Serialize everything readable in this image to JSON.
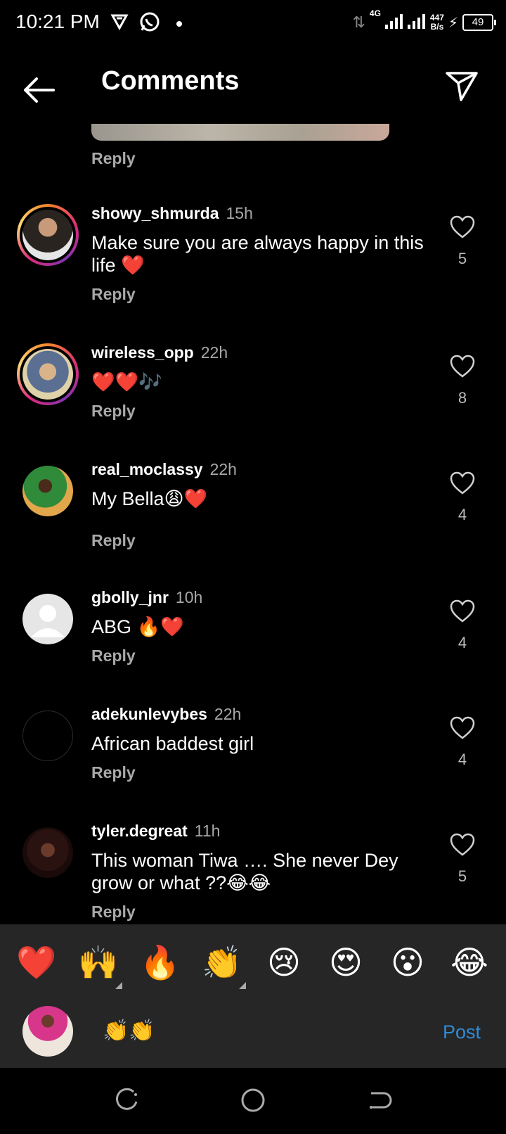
{
  "status_bar": {
    "time": "10:21 PM",
    "network": "4G",
    "speed_value": "447",
    "speed_unit": "B/s",
    "battery": "49"
  },
  "header": {
    "title": "Comments"
  },
  "top_reply": "Reply",
  "comments": [
    {
      "username": "showy_shmurda",
      "time": "15h",
      "text": "Make sure you are always happy in this life ❤️",
      "reply": "Reply",
      "likes": "5"
    },
    {
      "username": "wireless_opp",
      "time": "22h",
      "text": "❤️❤️🎶",
      "reply": "Reply",
      "likes": "8"
    },
    {
      "username": "real_moclassy",
      "time": "22h",
      "text": "My Bella😩❤️",
      "reply": "Reply",
      "likes": "4"
    },
    {
      "username": "gbolly_jnr",
      "time": "10h",
      "text": "ABG 🔥❤️",
      "reply": "Reply",
      "likes": "4"
    },
    {
      "username": "adekunlevybes",
      "time": "22h",
      "text": "African baddest girl",
      "reply": "Reply",
      "likes": "4"
    },
    {
      "username": "tyler.degreat",
      "time": "11h",
      "text": "This woman Tiwa …. She never Dey grow or what ??😂😂",
      "reply": "Reply",
      "likes": "5"
    }
  ],
  "emoji_bar": [
    "❤️",
    "🙌",
    "🔥",
    "👏",
    "😢",
    "😍",
    "😮",
    "😂"
  ],
  "composer": {
    "text": "👏👏",
    "post_label": "Post"
  },
  "colors": {
    "background": "#000000",
    "panel": "#262626",
    "secondary_text": "#a8a8a8",
    "post_blue": "#2f8cd8"
  }
}
